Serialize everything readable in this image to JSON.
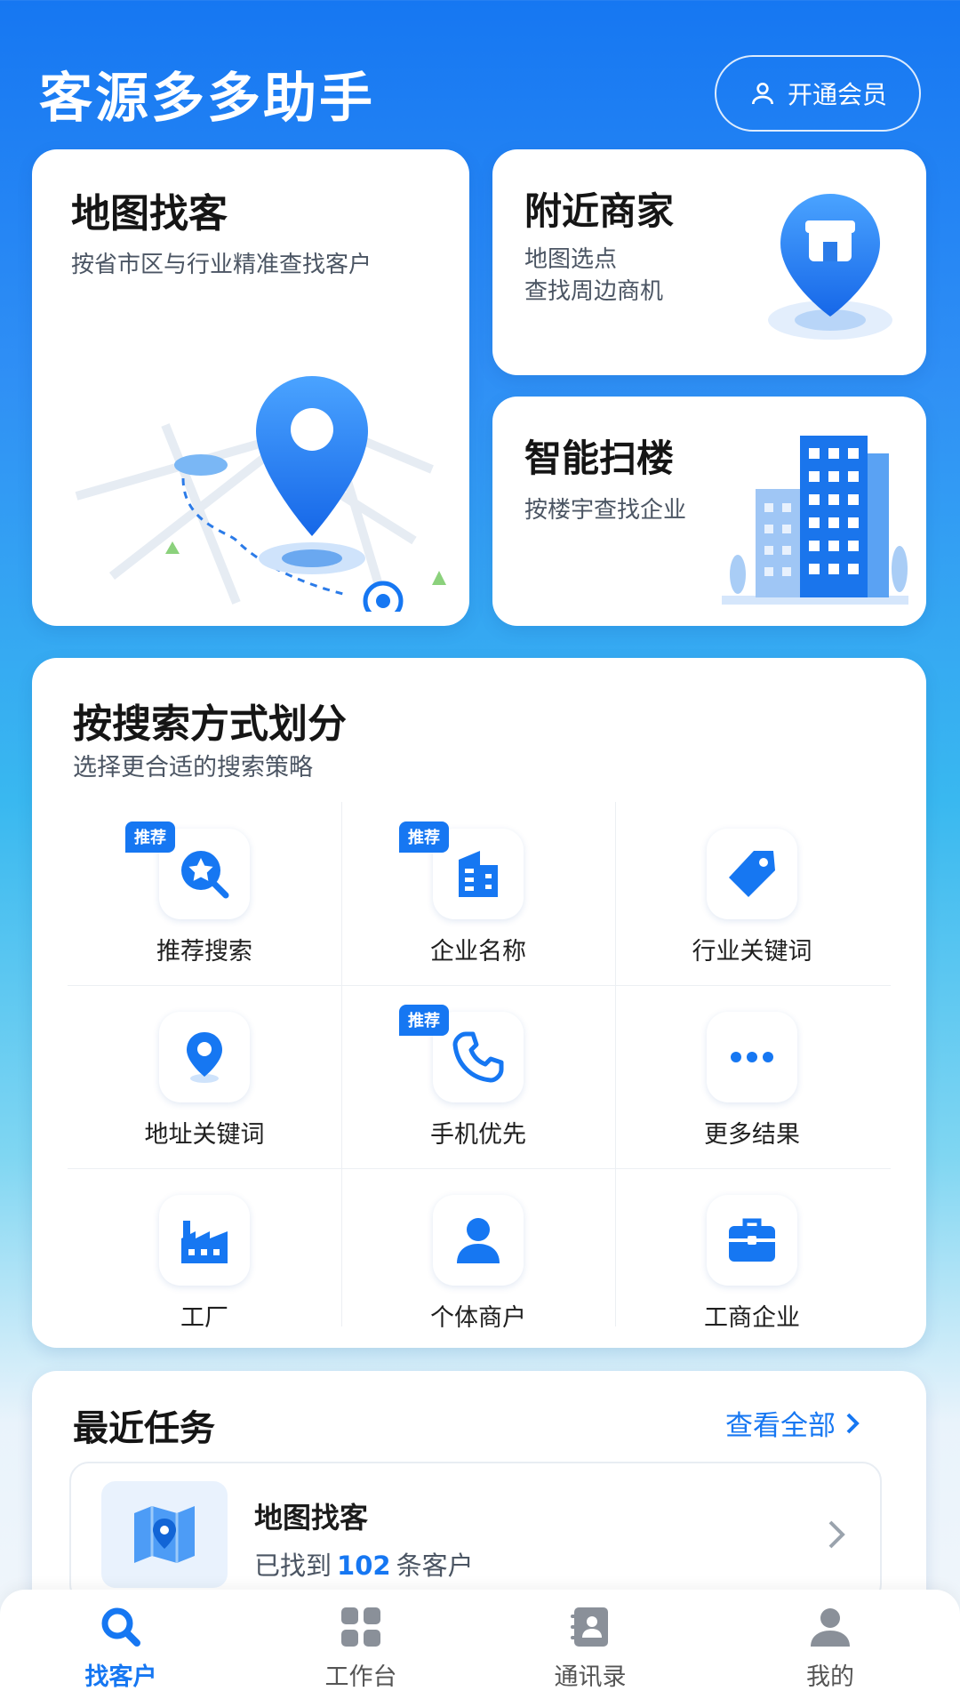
{
  "app": {
    "title": "客源多多助手",
    "vip_label": "开通会员"
  },
  "cards": {
    "map": {
      "title": "地图找客",
      "subtitle": "按省市区与行业精准查找客户"
    },
    "nearby": {
      "title": "附近商家",
      "subtitle_line1": "地图选点",
      "subtitle_line2": "查找周边商机"
    },
    "scan": {
      "title": "智能扫楼",
      "subtitle": "按楼宇查找企业"
    }
  },
  "search": {
    "title": "按搜索方式划分",
    "subtitle": "选择更合适的搜索策略",
    "badge_label": "推荐",
    "items": [
      {
        "label": "推荐搜索",
        "icon": "star-search-icon",
        "recommended": true
      },
      {
        "label": "企业名称",
        "icon": "building-icon",
        "recommended": true
      },
      {
        "label": "行业关键词",
        "icon": "tag-icon",
        "recommended": false
      },
      {
        "label": "地址关键词",
        "icon": "location-pin-icon",
        "recommended": false
      },
      {
        "label": "手机优先",
        "icon": "phone-icon",
        "recommended": true
      },
      {
        "label": "更多结果",
        "icon": "more-dots-icon",
        "recommended": false
      },
      {
        "label": "工厂",
        "icon": "factory-icon",
        "recommended": false
      },
      {
        "label": "个体商户",
        "icon": "person-icon",
        "recommended": false
      },
      {
        "label": "工商企业",
        "icon": "briefcase-icon",
        "recommended": false
      }
    ]
  },
  "recent": {
    "title": "最近任务",
    "view_all": "查看全部",
    "task": {
      "title": "地图找客",
      "desc_prefix": "已找到",
      "count": "102",
      "desc_suffix": "条客户"
    }
  },
  "tabs": [
    {
      "label": "找客户",
      "icon": "search-icon",
      "active": true
    },
    {
      "label": "工作台",
      "icon": "grid-icon",
      "active": false
    },
    {
      "label": "通讯录",
      "icon": "contacts-icon",
      "active": false
    },
    {
      "label": "我的",
      "icon": "profile-icon",
      "active": false
    }
  ],
  "colors": {
    "accent": "#1677f2",
    "text": "#1b1b1b",
    "muted": "#4b5563"
  }
}
